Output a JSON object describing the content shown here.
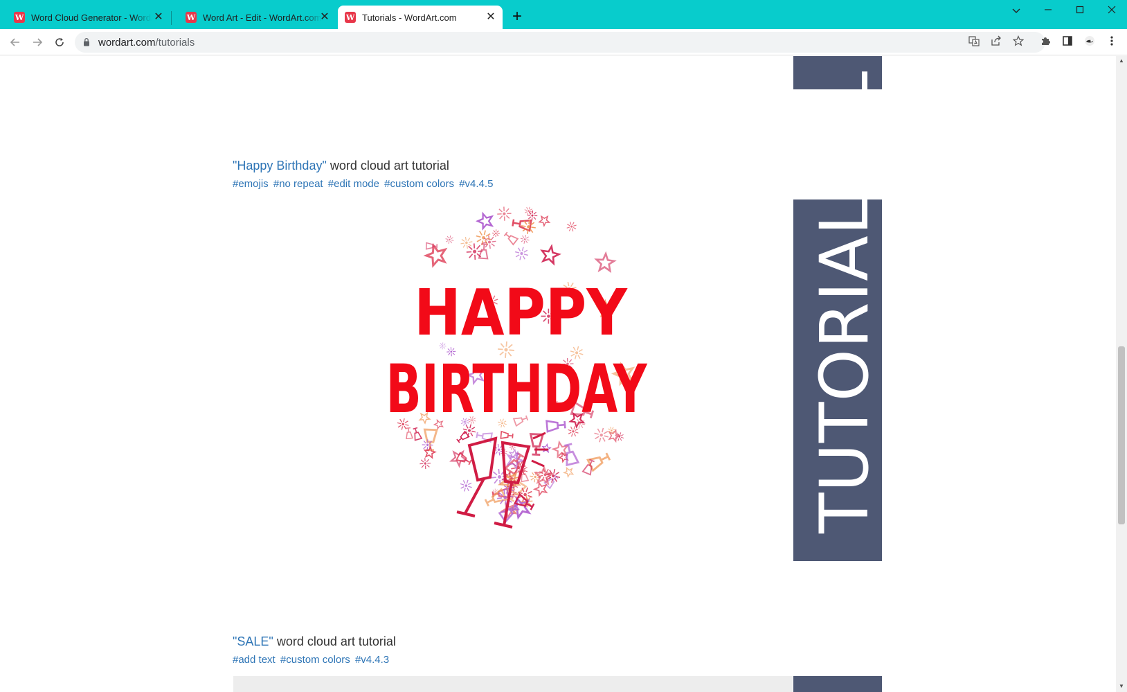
{
  "browser": {
    "tabs": [
      {
        "title": "Word Cloud Generator - WordArt.com",
        "favicon": "W"
      },
      {
        "title": "Word Art - Edit - WordArt.com",
        "favicon": "W"
      },
      {
        "title": "Tutorials - WordArt.com",
        "favicon": "W"
      }
    ],
    "new_tab_symbol": "+",
    "close_symbol": "✕",
    "url_host": "wordart.com",
    "url_path": "/tutorials",
    "accent_color": "#08cccc"
  },
  "page": {
    "banner_text": "TUTORIAL",
    "banner_color": "#4e5874",
    "entries": [
      {
        "title_quoted": "\"Happy Birthday\"",
        "title_rest": " word cloud art tutorial",
        "tags": [
          "#emojis",
          "#no repeat",
          "#edit mode",
          "#custom colors",
          "#v4.4.5"
        ]
      },
      {
        "title_quoted": "\"SALE\"",
        "title_rest": " word cloud art tutorial",
        "tags": [
          "#add text",
          "#custom colors",
          "#v4.4.3"
        ]
      }
    ],
    "artwork": {
      "line1": "HAPPY",
      "line2": "BIRTHDAY",
      "text_color": "#f20a18",
      "icon_colors": [
        "#e0475f",
        "#f09a5a",
        "#b060d0",
        "#d02050"
      ]
    }
  }
}
